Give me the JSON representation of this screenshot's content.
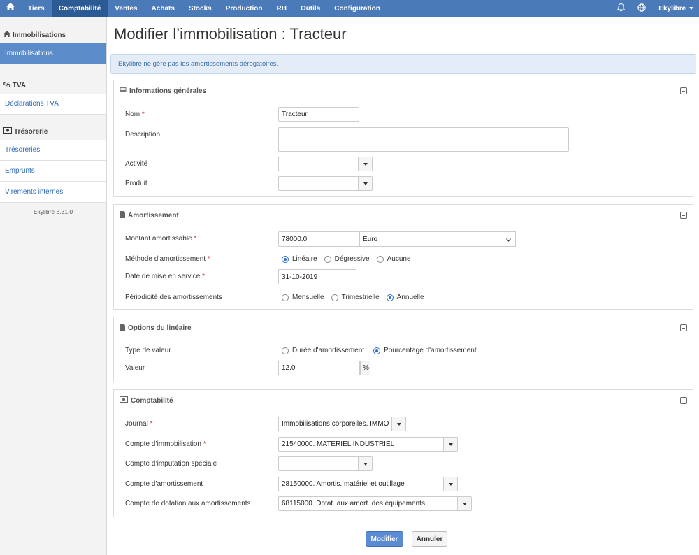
{
  "topnav": {
    "home_icon": "home-icon",
    "items": [
      "Tiers",
      "Comptabilité",
      "Ventes",
      "Achats",
      "Stocks",
      "Production",
      "RH",
      "Outils",
      "Configuration"
    ],
    "active": "Comptabilité",
    "bell_icon": "bell-icon",
    "globe_icon": "globe-icon",
    "user": "Ekylibre"
  },
  "sidebar": {
    "sections": [
      {
        "title": "Immobilisations",
        "icon": "home-icon",
        "links": [
          "Immobilisations"
        ]
      },
      {
        "title": "TVA",
        "icon": "percent-icon",
        "links": [
          "Déclarations TVA"
        ]
      },
      {
        "title": "Trésorerie",
        "icon": "money-icon",
        "links": [
          "Trésoreries",
          "Emprunts",
          "Virements internes"
        ]
      }
    ],
    "version": "Ekylibre 3.31.0"
  },
  "page": {
    "title": "Modifier l’immobilisation : Tracteur",
    "alert": "Ekylibre ne gère pas les amortissements dérogatoires."
  },
  "general": {
    "title": "Informations générales",
    "nom_label": "Nom",
    "nom_value": "Tracteur",
    "description_label": "Description",
    "description_value": "",
    "activite_label": "Activité",
    "activite_value": "",
    "produit_label": "Produit",
    "produit_value": ""
  },
  "amortissement": {
    "title": "Amortissement",
    "montant_label": "Montant amortissable",
    "montant_value": "78000.0",
    "currency": "Euro",
    "methode_label": "Méthode d’amortissement",
    "methode_options": [
      "Linéaire",
      "Dégressive",
      "Aucune"
    ],
    "methode_selected": "Linéaire",
    "date_label": "Date de mise en service",
    "date_value": "31-10-2019",
    "periodicite_label": "Périodicité des amortissements",
    "periodicite_options": [
      "Mensuelle",
      "Trimestrielle",
      "Annuelle"
    ],
    "periodicite_selected": "Annuelle"
  },
  "lineaire": {
    "title": "Options du linéaire",
    "type_label": "Type de valeur",
    "type_options": [
      "Durée d'amortissement",
      "Pourcentage d'amortissement"
    ],
    "type_selected": "Pourcentage d'amortissement",
    "valeur_label": "Valeur",
    "valeur_value": "12.0",
    "valeur_unit": "%"
  },
  "comptabilite": {
    "title": "Comptabilité",
    "journal_label": "Journal",
    "journal_value": "Immobilisations corporelles, IMMO",
    "compte_immo_label": "Compte d’immobilisation",
    "compte_immo_value": "21540000. MATERIEL INDUSTRIEL",
    "compte_imputation_label": "Compte d’imputation spéciale",
    "compte_imputation_value": "",
    "compte_amort_label": "Compte d’amortissement",
    "compte_amort_value": "28150000. Amortis. matériel et outillage",
    "compte_dotation_label": "Compte de dotation aux amortissements",
    "compte_dotation_value": "68115000. Dotat. aux amort. des équipements"
  },
  "actions": {
    "submit": "Modifier",
    "cancel": "Annuler"
  },
  "colors": {
    "topbar": "#4a7ab8",
    "active_tab": "#2c5a94",
    "primary_button": "#5b8bd2",
    "link": "#2f6ab1"
  }
}
